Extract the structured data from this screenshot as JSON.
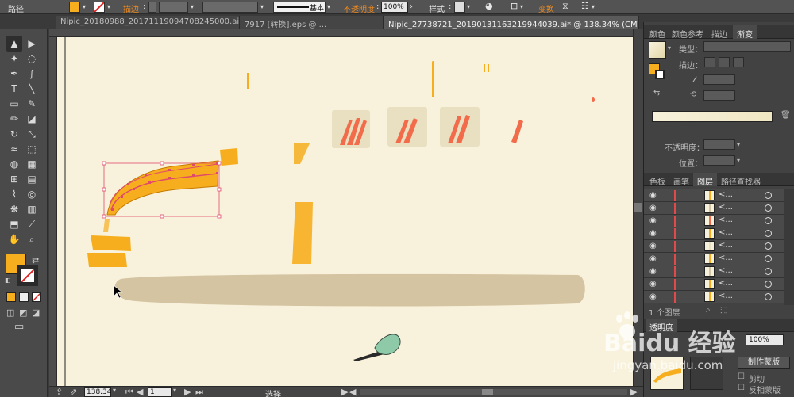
{
  "control_bar": {
    "object_type": "路径",
    "stroke_label": "描边",
    "opacity_label": "不透明度",
    "opacity_value": "100%",
    "brush_style": "基本",
    "style_label": "样式",
    "transform_label": "变换",
    "fill_color": "#f6ae1f",
    "stroke_color": "none"
  },
  "document_tabs": [
    {
      "label": "Nipic_20180988_20171119094708245000.ai*"
    },
    {
      "label": "7917 [转换].eps @ ..."
    },
    {
      "label": "Nipic_27738721_20190131163219944039.ai* @ 138.34% (CMYK/预览)"
    }
  ],
  "tools": [
    {
      "icon": "selection-icon",
      "glyph": "▲"
    },
    {
      "icon": "direct-selection-icon",
      "glyph": "▶"
    },
    {
      "icon": "magic-wand-icon",
      "glyph": "✦"
    },
    {
      "icon": "lasso-icon",
      "glyph": "◌"
    },
    {
      "icon": "pen-icon",
      "glyph": "✒"
    },
    {
      "icon": "curvature-icon",
      "glyph": "∫"
    },
    {
      "icon": "type-icon",
      "glyph": "T"
    },
    {
      "icon": "line-segment-icon",
      "glyph": "╲"
    },
    {
      "icon": "rectangle-icon",
      "glyph": "▭"
    },
    {
      "icon": "paintbrush-icon",
      "glyph": "✎"
    },
    {
      "icon": "pencil-icon",
      "glyph": "✏"
    },
    {
      "icon": "eraser-icon",
      "glyph": "◪"
    },
    {
      "icon": "rotate-icon",
      "glyph": "↻"
    },
    {
      "icon": "scale-icon",
      "glyph": "⤡"
    },
    {
      "icon": "warp-icon",
      "glyph": "≈"
    },
    {
      "icon": "free-transform-icon",
      "glyph": "⬚"
    },
    {
      "icon": "shape-builder-icon",
      "glyph": "◍"
    },
    {
      "icon": "perspective-grid-icon",
      "glyph": "▦"
    },
    {
      "icon": "mesh-icon",
      "glyph": "⊞"
    },
    {
      "icon": "gradient-icon",
      "glyph": "▤"
    },
    {
      "icon": "eyedropper-icon",
      "glyph": "⌇"
    },
    {
      "icon": "blend-icon",
      "glyph": "◎"
    },
    {
      "icon": "symbol-sprayer-icon",
      "glyph": "❋"
    },
    {
      "icon": "column-graph-icon",
      "glyph": "▥"
    },
    {
      "icon": "artboard-icon",
      "glyph": "⬒"
    },
    {
      "icon": "slice-icon",
      "glyph": "⟋"
    },
    {
      "icon": "hand-icon",
      "glyph": "✋"
    },
    {
      "icon": "zoom-icon",
      "glyph": "⌕"
    }
  ],
  "toolbar_colors": {
    "fill": "#f6ae1f",
    "stroke": "none"
  },
  "status_bar": {
    "zoom": "138.34",
    "artboard": "1",
    "tool_name": "选择"
  },
  "panel_gradient": {
    "tabs": [
      "颜色",
      "颜色参考",
      "描边",
      "渐变"
    ],
    "type_label": "类型：",
    "stroke_label": "描边：",
    "opacity_label": "不透明度：",
    "position_label": "位置：",
    "gradient_start": "#f8f2dc",
    "gradient_end": "#efe6c2"
  },
  "panel_layers": {
    "tabs": [
      "色板",
      "画笔",
      "图层",
      "路径查找器"
    ],
    "rows": [
      {
        "name": "<..."
      },
      {
        "name": "<..."
      },
      {
        "name": "<..."
      },
      {
        "name": "<..."
      },
      {
        "name": "<..."
      },
      {
        "name": "<..."
      },
      {
        "name": "<..."
      },
      {
        "name": "<..."
      },
      {
        "name": "<..."
      }
    ],
    "layer_count": "1 个图层"
  },
  "panel_transparency": {
    "tab": "透明度",
    "opacity_value": "100%",
    "make_mask": "制作蒙版",
    "clip_label": "剪切",
    "invert_label": "反相蒙版"
  },
  "watermark": {
    "brand": "Baidu 经验",
    "url": "jingyan.baidu.com"
  }
}
